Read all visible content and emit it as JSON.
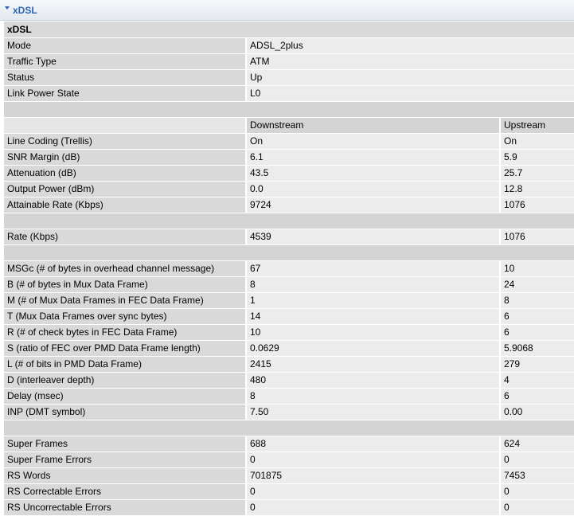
{
  "panel": {
    "title": "xDSL"
  },
  "section_title": "xDSL",
  "info_rows": [
    {
      "label": "Mode",
      "value": "ADSL_2plus"
    },
    {
      "label": "Traffic Type",
      "value": "ATM"
    },
    {
      "label": "Status",
      "value": "Up"
    },
    {
      "label": "Link Power State",
      "value": "L0"
    }
  ],
  "columns": {
    "downstream": "Downstream",
    "upstream": "Upstream"
  },
  "line_rows": [
    {
      "label": "Line Coding (Trellis)",
      "down": "On",
      "up": "On"
    },
    {
      "label": "SNR Margin (dB)",
      "down": "6.1",
      "up": "5.9"
    },
    {
      "label": "Attenuation (dB)",
      "down": "43.5",
      "up": "25.7"
    },
    {
      "label": "Output Power (dBm)",
      "down": "0.0",
      "up": "12.8"
    },
    {
      "label": "Attainable Rate (Kbps)",
      "down": "9724",
      "up": "1076"
    }
  ],
  "rate_rows": [
    {
      "label": "Rate (Kbps)",
      "down": "4539",
      "up": "1076"
    }
  ],
  "frame_rows": [
    {
      "label": "MSGc (# of bytes in overhead channel message)",
      "down": "67",
      "up": "10"
    },
    {
      "label": "B (# of bytes in Mux Data Frame)",
      "down": "8",
      "up": "24"
    },
    {
      "label": "M (# of Mux Data Frames in FEC Data Frame)",
      "down": "1",
      "up": "8"
    },
    {
      "label": "T (Mux Data Frames over sync bytes)",
      "down": "14",
      "up": "6"
    },
    {
      "label": "R (# of check bytes in FEC Data Frame)",
      "down": "10",
      "up": "6"
    },
    {
      "label": "S (ratio of FEC over PMD Data Frame length)",
      "down": "0.0629",
      "up": "5.9068"
    },
    {
      "label": "L (# of bits in PMD Data Frame)",
      "down": "2415",
      "up": "279"
    },
    {
      "label": "D (interleaver depth)",
      "down": "480",
      "up": "4"
    },
    {
      "label": "Delay (msec)",
      "down": "8",
      "up": "6"
    },
    {
      "label": "INP (DMT symbol)",
      "down": "7.50",
      "up": "0.00"
    }
  ],
  "error_rows": [
    {
      "label": "Super Frames",
      "down": "688",
      "up": "624"
    },
    {
      "label": "Super Frame Errors",
      "down": "0",
      "up": "0"
    },
    {
      "label": "RS Words",
      "down": "701875",
      "up": "7453"
    },
    {
      "label": "RS Correctable Errors",
      "down": "0",
      "up": "0"
    },
    {
      "label": "RS Uncorrectable Errors",
      "down": "0",
      "up": "0"
    }
  ],
  "colors": {
    "header_text": "#2a63b8",
    "label_bg": "#d9d9d9",
    "value_bg": "#ececec"
  },
  "icons": {
    "collapse": "triangle-down-icon"
  }
}
